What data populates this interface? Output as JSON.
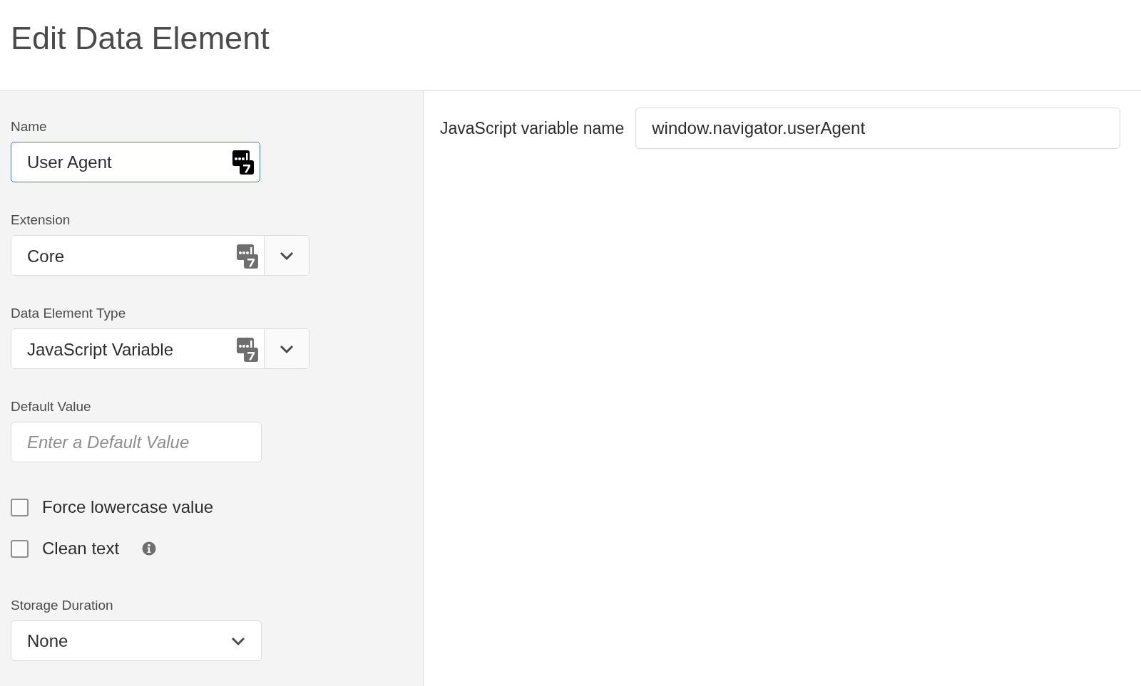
{
  "title": "Edit Data Element",
  "fields": [
    {
      "kind": "text",
      "label": "Name",
      "value": "User Agent",
      "focused": true
    },
    {
      "kind": "select",
      "label": "Extension",
      "value": "Core",
      "focused": false
    },
    {
      "kind": "select",
      "label": "Data Element Type",
      "value": "JavaScript Variable",
      "focused": false
    },
    {
      "kind": "input",
      "label": "Default Value",
      "placeholder": "Enter a Default Value",
      "focused": false
    }
  ],
  "checkboxes": [
    {
      "label": "Force lowercase value",
      "checked": false,
      "info": false
    },
    {
      "label": "Clean text",
      "checked": false,
      "info": true
    }
  ],
  "storage_duration": {
    "label": "Storage Duration",
    "value": "None"
  },
  "settings": {
    "label": "JavaScript variable name",
    "value": "window.navigator.userAgent"
  }
}
